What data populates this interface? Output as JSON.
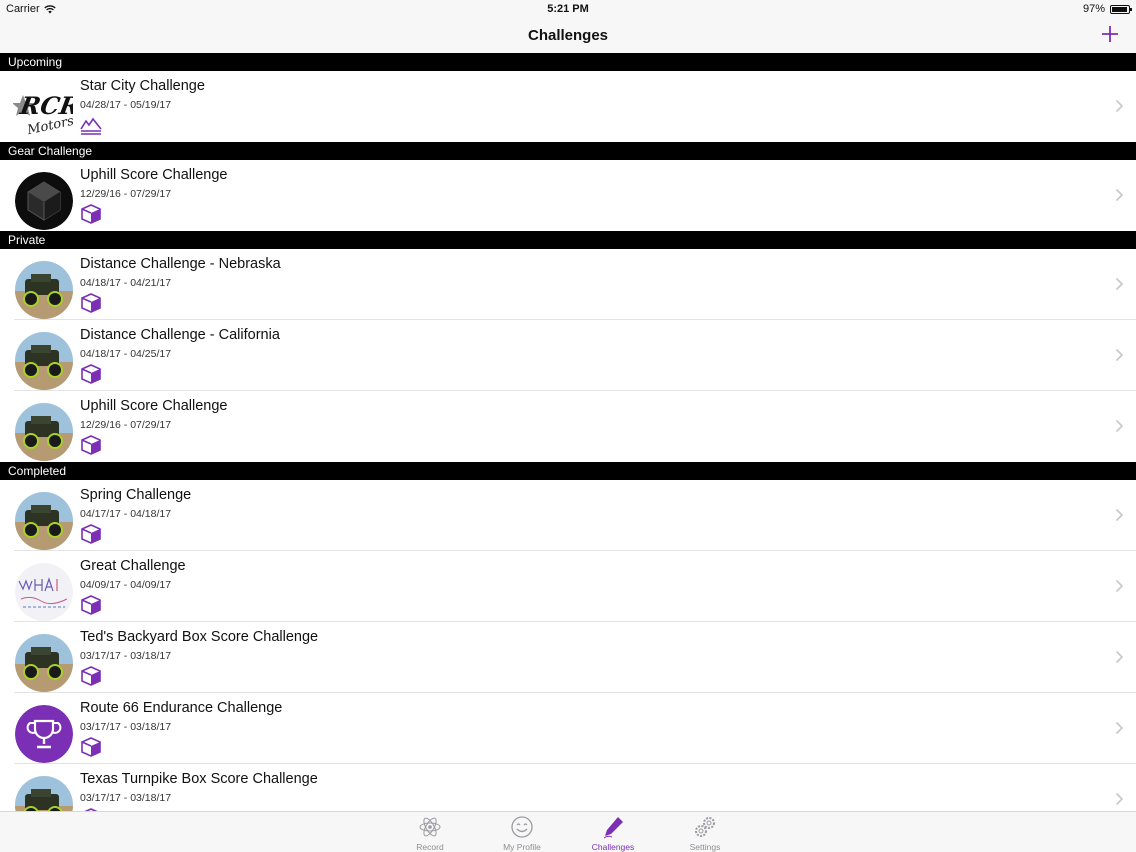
{
  "status_bar": {
    "carrier": "Carrier",
    "time": "5:21 PM",
    "battery": "97%"
  },
  "nav": {
    "title": "Challenges",
    "add_icon": "plus-icon"
  },
  "colors": {
    "accent": "#7b2fb5",
    "section_bg": "#000000",
    "bar_bg": "#f7f7f7"
  },
  "sections": [
    {
      "title": "Upcoming",
      "items": [
        {
          "name": "Star City Challenge",
          "dates": "04/28/17 - 05/19/17",
          "avatar": "rcr-motorsports-logo",
          "type_icon": "mountain-icon"
        }
      ]
    },
    {
      "title": "Gear Challenge",
      "items": [
        {
          "name": "Uphill Score Challenge",
          "dates": "12/29/16 - 07/29/17",
          "avatar": "dark-gem-logo",
          "type_icon": "box-icon"
        }
      ]
    },
    {
      "title": "Private",
      "items": [
        {
          "name": "Distance Challenge - Nebraska",
          "dates": "04/18/17 - 04/21/17",
          "avatar": "rc-truck-photo",
          "type_icon": "box-icon"
        },
        {
          "name": "Distance Challenge - California",
          "dates": "04/18/17 - 04/25/17",
          "avatar": "rc-truck-photo",
          "type_icon": "box-icon"
        },
        {
          "name": "Uphill Score Challenge",
          "dates": "12/29/16 - 07/29/17",
          "avatar": "rc-truck-photo",
          "type_icon": "box-icon"
        }
      ]
    },
    {
      "title": "Completed",
      "items": [
        {
          "name": "Spring Challenge",
          "dates": "04/17/17 - 04/18/17",
          "avatar": "rc-truck-photo",
          "type_icon": "box-icon"
        },
        {
          "name": "Great Challenge",
          "dates": "04/09/17 - 04/09/17",
          "avatar": "whiteboard-sketch",
          "type_icon": "box-icon"
        },
        {
          "name": "Ted's Backyard Box Score Challenge",
          "dates": "03/17/17 - 03/18/17",
          "avatar": "rc-truck-photo",
          "type_icon": "box-icon"
        },
        {
          "name": "Route 66 Endurance Challenge",
          "dates": "03/17/17 - 03/18/17",
          "avatar": "trophy-icon",
          "type_icon": "box-icon"
        },
        {
          "name": "Texas Turnpike Box Score Challenge",
          "dates": "03/17/17 - 03/18/17",
          "avatar": "rc-truck-photo",
          "type_icon": "box-icon"
        }
      ]
    }
  ],
  "tabs": [
    {
      "label": "Record",
      "icon": "atom-icon",
      "active": false
    },
    {
      "label": "My Profile",
      "icon": "smiley-icon",
      "active": false
    },
    {
      "label": "Challenges",
      "icon": "pen-icon",
      "active": true
    },
    {
      "label": "Settings",
      "icon": "gears-icon",
      "active": false
    }
  ]
}
